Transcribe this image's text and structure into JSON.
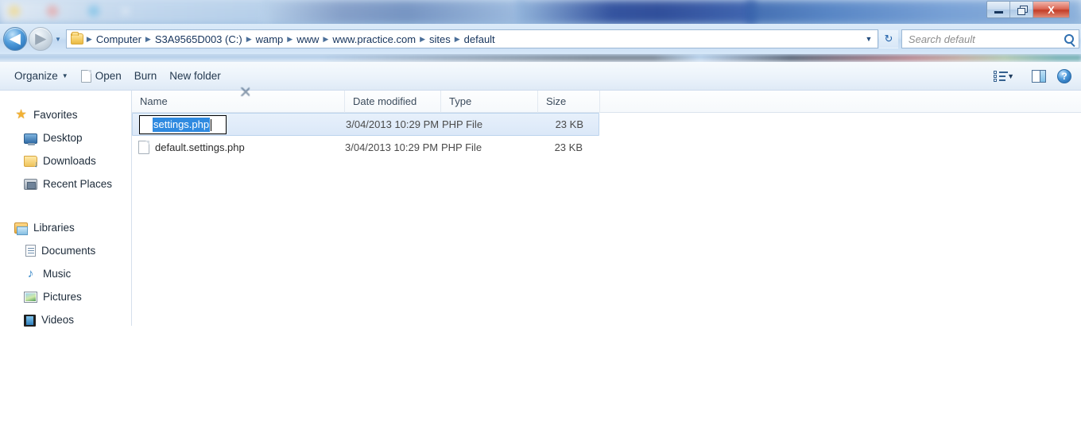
{
  "window": {
    "controls": {
      "minimize_label": "Minimize",
      "restore_label": "Restore",
      "close_label": "X"
    }
  },
  "addressbar": {
    "back_label": "◀",
    "forward_label": "▶",
    "history_caret": "▼",
    "folder_icon": "folder-icon",
    "breadcrumbs": [
      "Computer",
      "S3A9565D003 (C:)",
      "wamp",
      "www",
      "www.practice.com",
      "sites",
      "default"
    ],
    "separator": "▶",
    "dropdown_caret": "▼",
    "refresh_label": "↻"
  },
  "search": {
    "placeholder": "Search default",
    "icon": "search-icon"
  },
  "toolbar": {
    "organize_label": "Organize",
    "organize_caret": "▼",
    "open_label": "Open",
    "burn_label": "Burn",
    "new_folder_label": "New folder",
    "views_caret": "▼",
    "help_label": "?"
  },
  "sidebar": {
    "groups": [
      {
        "header": {
          "label": "Favorites",
          "icon": "star-icon"
        },
        "items": [
          {
            "label": "Desktop",
            "icon": "desktop-icon"
          },
          {
            "label": "Downloads",
            "icon": "downloads-folder-icon"
          },
          {
            "label": "Recent Places",
            "icon": "recent-places-icon"
          }
        ]
      },
      {
        "header": {
          "label": "Libraries",
          "icon": "libraries-icon"
        },
        "items": [
          {
            "label": "Documents",
            "icon": "documents-icon"
          },
          {
            "label": "Music",
            "icon": "music-note-icon"
          },
          {
            "label": "Pictures",
            "icon": "pictures-icon"
          },
          {
            "label": "Videos",
            "icon": "videos-icon"
          }
        ]
      }
    ]
  },
  "filelist": {
    "columns": [
      "Name",
      "Date modified",
      "Type",
      "Size"
    ],
    "rows": [
      {
        "name": "settings.php",
        "date_modified": "3/04/2013 10:29 PM",
        "type": "PHP File",
        "size": "23 KB",
        "selected": true,
        "renaming": true
      },
      {
        "name": "default.settings.php",
        "date_modified": "3/04/2013 10:29 PM",
        "type": "PHP File",
        "size": "23 KB",
        "selected": false,
        "renaming": false
      }
    ],
    "rename_value": "settings.php"
  },
  "colors": {
    "selection_highlight": "#2f8ae0",
    "row_selected_bg": "#dbe8f8",
    "chrome_blue": "#cfe2f5",
    "accent_text": "#15335c"
  }
}
